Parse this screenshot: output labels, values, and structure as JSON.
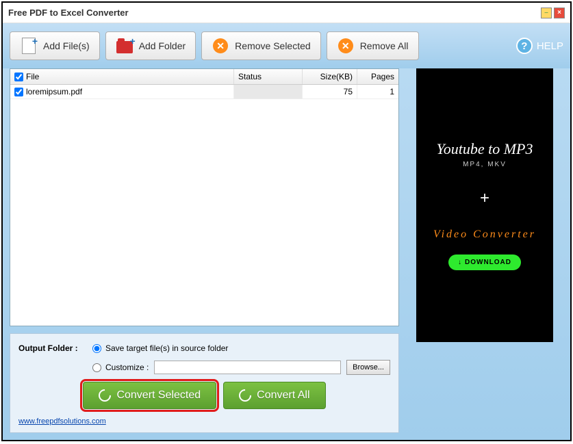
{
  "window": {
    "title": "Free PDF to Excel Converter"
  },
  "toolbar": {
    "add_files": "Add File(s)",
    "add_folder": "Add Folder",
    "remove_selected": "Remove Selected",
    "remove_all": "Remove All",
    "help": "HELP"
  },
  "table": {
    "headers": {
      "file": "File",
      "status": "Status",
      "size": "Size(KB)",
      "pages": "Pages"
    },
    "rows": [
      {
        "checked": true,
        "file": "loremipsum.pdf",
        "status": "",
        "size": "75",
        "pages": "1"
      }
    ]
  },
  "output": {
    "label": "Output Folder :",
    "save_source": "Save target file(s) in source folder",
    "customize": "Customize :",
    "customize_value": "",
    "browse": "Browse...",
    "convert_selected": "Convert Selected",
    "convert_all": "Convert All",
    "link": "www.freepdfsolutions.com"
  },
  "ad": {
    "title": "Youtube to MP3",
    "sub": "MP4, MKV",
    "plus": "+",
    "vc": "Video Converter",
    "download": "DOWNLOAD"
  }
}
